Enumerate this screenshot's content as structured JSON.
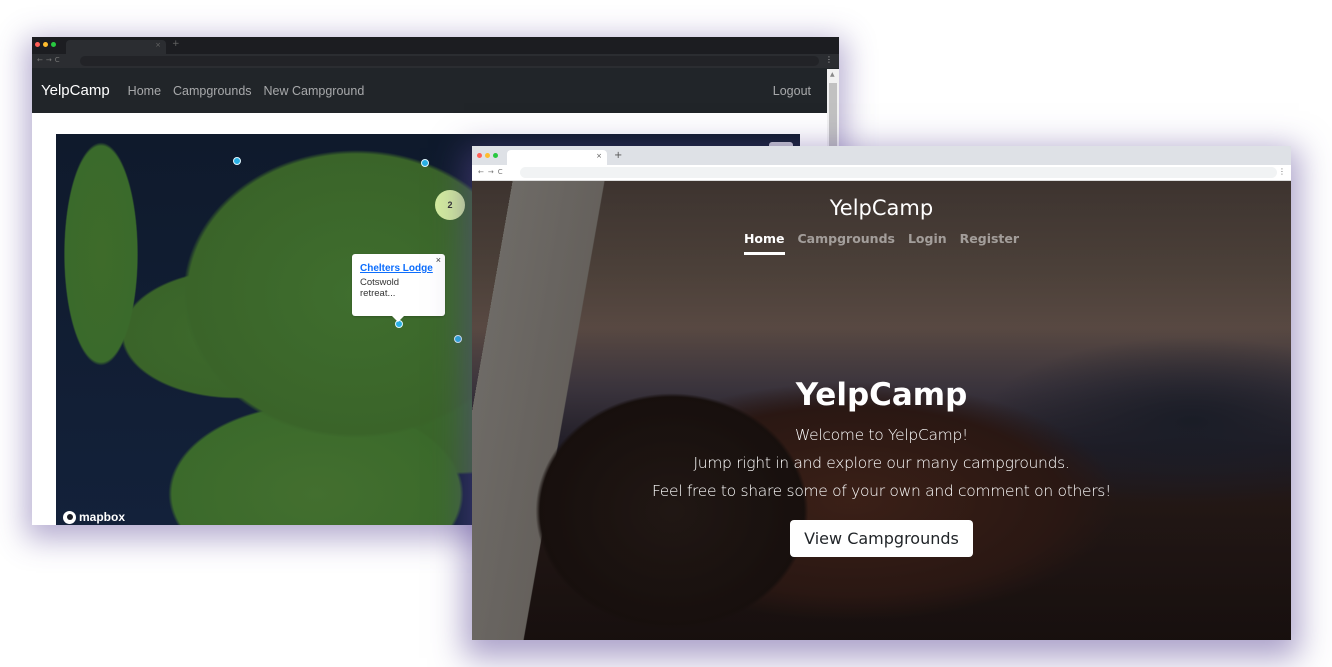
{
  "back_window": {
    "tab": {
      "close_glyph": "×",
      "new_tab_glyph": "+"
    },
    "nav_glyphs": {
      "back": "←",
      "forward": "→",
      "reload": "C",
      "menu": "⋮"
    },
    "navbar": {
      "brand": "YelpCamp",
      "links": [
        "Home",
        "Campgrounds",
        "New Campground"
      ],
      "logout": "Logout"
    },
    "map": {
      "cluster_count": "2",
      "popup": {
        "title": "Chelters Lodge",
        "description": "Cotswold retreat...",
        "close_glyph": "×"
      },
      "attribution": "mapbox",
      "marker_color": "#2ab0e4",
      "cluster_color": "#d3ec9f"
    }
  },
  "front_window": {
    "tab": {
      "close_glyph": "×",
      "new_tab_glyph": "+"
    },
    "nav_glyphs": {
      "back": "←",
      "forward": "→",
      "reload": "C",
      "menu": "⋮"
    },
    "header": {
      "brand": "YelpCamp",
      "nav": [
        {
          "label": "Home",
          "active": true
        },
        {
          "label": "Campgrounds",
          "active": false
        },
        {
          "label": "Login",
          "active": false
        },
        {
          "label": "Register",
          "active": false
        }
      ]
    },
    "hero": {
      "title": "YelpCamp",
      "lines": [
        "Welcome to YelpCamp!",
        "Jump right in and explore our many campgrounds.",
        "Feel free to share some of your own and comment on others!"
      ],
      "button": "View Campgrounds"
    }
  }
}
